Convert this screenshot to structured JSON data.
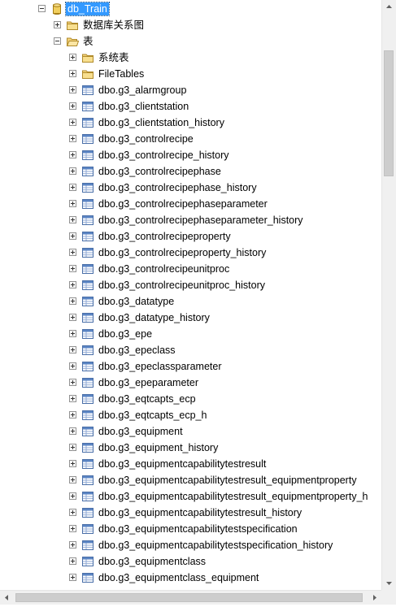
{
  "tree": {
    "database": {
      "label": "db_Train",
      "expanded": true,
      "selected": true,
      "icon": "database-cylinder-icon"
    },
    "diagrams": {
      "label": "数据库关系图",
      "expanded": false,
      "icon": "folder-icon"
    },
    "tables_folder": {
      "label": "表",
      "expanded": true,
      "icon": "folder-icon"
    },
    "subfolders": [
      {
        "label": "系统表",
        "icon": "folder-icon"
      },
      {
        "label": "FileTables",
        "icon": "folder-icon"
      }
    ],
    "tables": [
      "dbo.g3_alarmgroup",
      "dbo.g3_clientstation",
      "dbo.g3_clientstation_history",
      "dbo.g3_controlrecipe",
      "dbo.g3_controlrecipe_history",
      "dbo.g3_controlrecipephase",
      "dbo.g3_controlrecipephase_history",
      "dbo.g3_controlrecipephaseparameter",
      "dbo.g3_controlrecipephaseparameter_history",
      "dbo.g3_controlrecipeproperty",
      "dbo.g3_controlrecipeproperty_history",
      "dbo.g3_controlrecipeunitproc",
      "dbo.g3_controlrecipeunitproc_history",
      "dbo.g3_datatype",
      "dbo.g3_datatype_history",
      "dbo.g3_epe",
      "dbo.g3_epeclass",
      "dbo.g3_epeclassparameter",
      "dbo.g3_epeparameter",
      "dbo.g3_eqtcapts_ecp",
      "dbo.g3_eqtcapts_ecp_h",
      "dbo.g3_equipment",
      "dbo.g3_equipment_history",
      "dbo.g3_equipmentcapabilitytestresult",
      "dbo.g3_equipmentcapabilitytestresult_equipmentproperty",
      "dbo.g3_equipmentcapabilitytestresult_equipmentproperty_h",
      "dbo.g3_equipmentcapabilitytestresult_history",
      "dbo.g3_equipmentcapabilitytestspecification",
      "dbo.g3_equipmentcapabilitytestspecification_history",
      "dbo.g3_equipmentclass",
      "dbo.g3_equipmentclass_equipment"
    ],
    "table_icon": "table-icon"
  },
  "colors": {
    "selection": "#3399ff",
    "folder": "#e8c25a",
    "table_icon": "#2f5fa7",
    "database": "#e0b43c"
  }
}
